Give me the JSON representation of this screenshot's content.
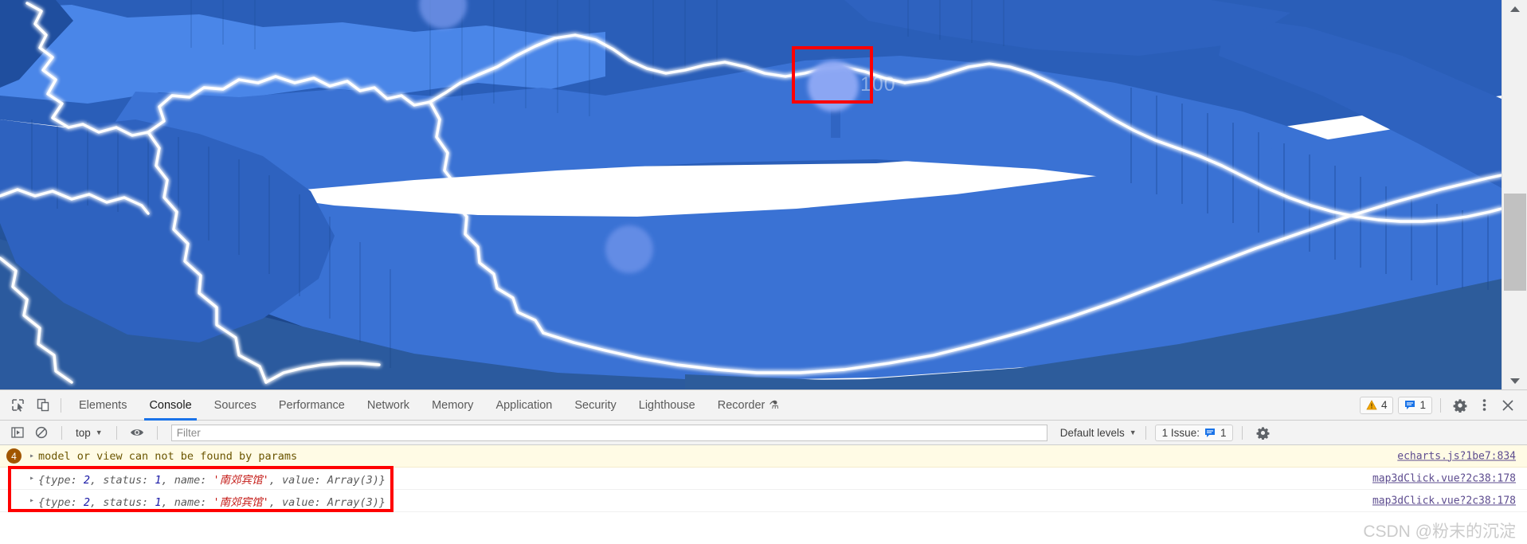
{
  "viewport": {
    "map_label": "100",
    "colors": {
      "map_top": "#3a72d4",
      "map_top_light": "#4a86e8",
      "map_side_dark": "#1f4e9e",
      "map_side_mid": "#2a5cb4",
      "border_glow": "#ffffff",
      "marker": "#7d9cf0",
      "annotation": "#ff0000",
      "background": "#ffffff"
    },
    "scrollbar": {
      "name": "vertical-scrollbar"
    }
  },
  "devtools": {
    "left_icons": [
      {
        "name": "inspect-element-icon",
        "label": "Inspect element"
      },
      {
        "name": "device-toolbar-icon",
        "label": "Toggle device toolbar"
      }
    ],
    "tabs": [
      {
        "label": "Elements",
        "active": false
      },
      {
        "label": "Console",
        "active": true
      },
      {
        "label": "Sources",
        "active": false
      },
      {
        "label": "Performance",
        "active": false
      },
      {
        "label": "Network",
        "active": false
      },
      {
        "label": "Memory",
        "active": false
      },
      {
        "label": "Application",
        "active": false
      },
      {
        "label": "Security",
        "active": false
      },
      {
        "label": "Lighthouse",
        "active": false
      },
      {
        "label": "Recorder",
        "active": false,
        "badge": "flask"
      }
    ],
    "status": {
      "warnings_count": "4",
      "issues_count": "1"
    },
    "right_icons": [
      {
        "name": "settings-gear-icon"
      },
      {
        "name": "more-options-icon"
      },
      {
        "name": "close-devtools-icon"
      }
    ]
  },
  "console": {
    "toolbar": {
      "sidebar_toggle": "console-sidebar-icon",
      "clear_label": "clear-console-icon",
      "context": "top",
      "eye_icon": "live-expression-icon",
      "filter_placeholder": "Filter",
      "filter_value": "",
      "levels": "Default levels",
      "issues_label": "1 Issue:",
      "issues_count": "1",
      "settings_icon": "console-settings-icon"
    },
    "messages": [
      {
        "kind": "warning",
        "count": "4",
        "text": "model or view can not be found by params",
        "source": "echarts.js?1be7:834",
        "annotated": false
      },
      {
        "kind": "log",
        "prefix": "{type: ",
        "type_value": "2",
        "mid1": ", status: ",
        "status_value": "1",
        "mid2": ", name: ",
        "name_value": "'南郊宾馆'",
        "mid3": ", value: Array(3)}",
        "source": "map3dClick.vue?2c38:178",
        "annotated": true
      },
      {
        "kind": "log",
        "prefix": "{type: ",
        "type_value": "2",
        "mid1": ", status: ",
        "status_value": "1",
        "mid2": ", name: ",
        "name_value": "'南郊宾馆'",
        "mid3": ", value: Array(3)}",
        "source": "map3dClick.vue?2c38:178",
        "annotated": true
      }
    ]
  },
  "watermark": "CSDN @粉末的沉淀"
}
